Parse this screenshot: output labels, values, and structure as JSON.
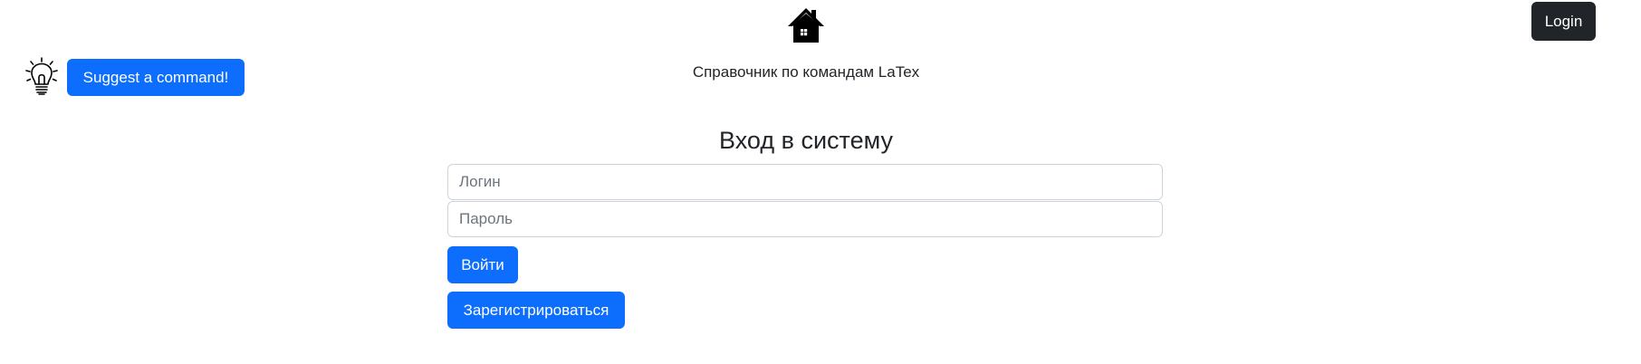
{
  "header": {
    "home_icon": "house-icon",
    "subtitle": "Справочник по командам LaTex",
    "login_label": "Login"
  },
  "suggest": {
    "icon": "lightbulb-icon",
    "button_label": "Suggest a command!"
  },
  "form": {
    "title": "Вход в систему",
    "login_field": {
      "placeholder": "Логин",
      "value": ""
    },
    "password_field": {
      "placeholder": "Пароль",
      "value": ""
    },
    "submit_label": "Войти",
    "register_label": "Зарегистрироваться"
  },
  "colors": {
    "primary": "#0d6efd",
    "dark": "#212529",
    "input_border": "#ced4da",
    "placeholder": "#6c757d"
  }
}
